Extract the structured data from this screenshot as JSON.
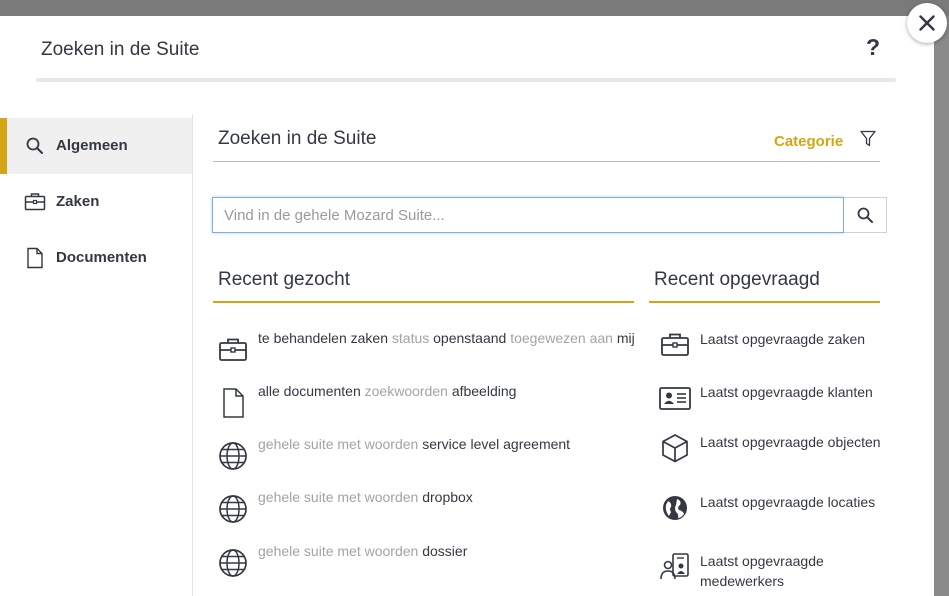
{
  "modal": {
    "title": "Zoeken in de Suite",
    "help_label": "?"
  },
  "sidebar": {
    "items": [
      {
        "label": "Algemeen",
        "icon": "search-icon",
        "active": true
      },
      {
        "label": "Zaken",
        "icon": "briefcase-icon",
        "active": false
      },
      {
        "label": "Documenten",
        "icon": "document-icon",
        "active": false
      }
    ]
  },
  "main": {
    "title": "Zoeken in de Suite",
    "category_label": "Categorie",
    "search": {
      "placeholder": "Vind in de gehele Mozard Suite...",
      "value": ""
    }
  },
  "recent_searched": {
    "title": "Recent gezocht",
    "items": [
      {
        "icon": "briefcase-icon",
        "parts": [
          "te behandelen zaken",
          " status ",
          "openstaand",
          " toegewezen aan ",
          "mij"
        ]
      },
      {
        "icon": "document-icon",
        "parts": [
          "alle documenten",
          " zoekwoorden ",
          "afbeelding"
        ]
      },
      {
        "icon": "globe-icon",
        "parts": [
          "gehele suite met woorden",
          " ",
          "service level agreement"
        ]
      },
      {
        "icon": "globe-icon",
        "parts": [
          "gehele suite met woorden",
          " ",
          "dropbox"
        ]
      },
      {
        "icon": "globe-icon",
        "parts": [
          "gehele suite met woorden",
          " ",
          "dossier"
        ]
      }
    ]
  },
  "recent_viewed": {
    "title": "Recent opgevraagd",
    "items": [
      {
        "icon": "briefcase-icon",
        "label": "Laatst opgevraagde zaken"
      },
      {
        "icon": "contact-card-icon",
        "label": "Laatst opgevraagde klanten"
      },
      {
        "icon": "cube-icon",
        "label": "Laatst opgevraagde objecten"
      },
      {
        "icon": "earth-icon",
        "label": "Laatst opgevraagde locaties"
      },
      {
        "icon": "employees-icon",
        "label": "Laatst opgevraagde medewerkers"
      }
    ]
  },
  "colors": {
    "accent": "#d4a514",
    "text": "#333842",
    "muted": "#a3a3a3",
    "focus": "#7fb0e0"
  }
}
